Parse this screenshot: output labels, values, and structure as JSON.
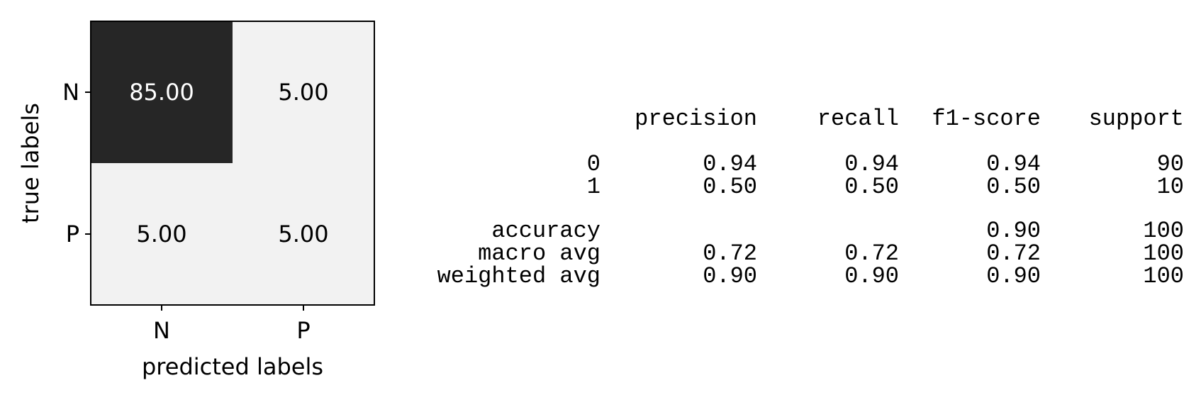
{
  "chart_data": [
    {
      "type": "heatmap",
      "xlabel": "predicted labels",
      "ylabel": "true labels",
      "x_categories": [
        "N",
        "P"
      ],
      "y_categories": [
        "N",
        "P"
      ],
      "values": [
        [
          85.0,
          5.0
        ],
        [
          5.0,
          5.0
        ]
      ],
      "value_labels": [
        [
          "85.00",
          "5.00"
        ],
        [
          "5.00",
          "5.00"
        ]
      ],
      "colors": {
        "high": "#262626",
        "low": "#f2f2f2",
        "text_on_dark": "#ffffff",
        "text_on_light": "#000000"
      }
    },
    {
      "type": "table",
      "columns": [
        "precision",
        "recall",
        "f1-score",
        "support"
      ],
      "rows": [
        {
          "label": "0",
          "values": [
            "0.94",
            "0.94",
            "0.94",
            "90"
          ]
        },
        {
          "label": "1",
          "values": [
            "0.50",
            "0.50",
            "0.50",
            "10"
          ]
        },
        {
          "label": "accuracy",
          "values": [
            "",
            "",
            "0.90",
            "100"
          ]
        },
        {
          "label": "macro avg",
          "values": [
            "0.72",
            "0.72",
            "0.72",
            "100"
          ]
        },
        {
          "label": "weighted avg",
          "values": [
            "0.90",
            "0.90",
            "0.90",
            "100"
          ]
        }
      ]
    }
  ]
}
